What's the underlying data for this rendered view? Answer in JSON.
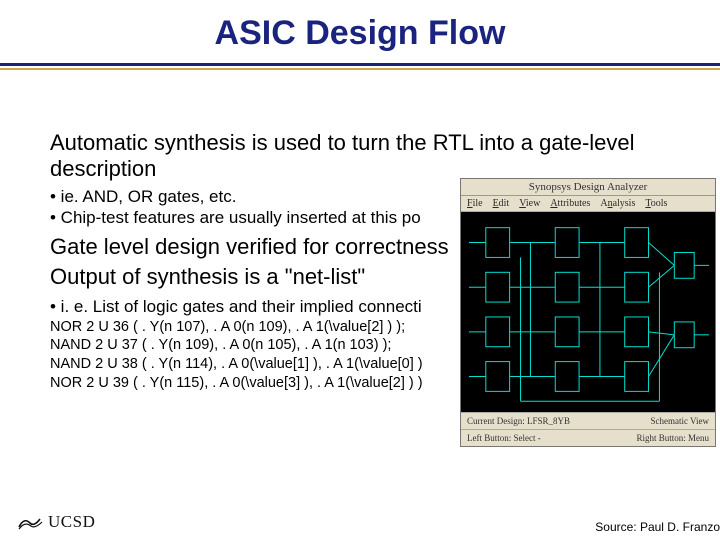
{
  "title": "ASIC Design Flow",
  "body": {
    "p1": "Automatic synthesis is used to turn the RTL into a gate-level description",
    "b1": "• ie. AND, OR gates, etc.",
    "b2": "• Chip-test features are usually inserted at this po",
    "p2": "Gate level design verified for correctness",
    "p3": "Output of synthesis is a \"net-list\"",
    "b3": "• i. e. List of logic gates and their implied connecti",
    "code1": "NOR 2 U 36 ( . Y(n 107), . A 0(n 109), . A 1(\\value[2] ) );",
    "code2": "NAND 2 U 37 ( . Y(n 109), . A 0(n 105), . A 1(n 103) );",
    "code3": "NAND 2 U 38 ( . Y(n 114), . A 0(\\value[1] ), . A 1(\\value[0] )",
    "code4": "NOR 2 U 39 ( . Y(n 115), . A 0(\\value[3] ), . A 1(\\value[2] ) )"
  },
  "figure": {
    "titlebar": "Synopsys Design Analyzer",
    "menu": {
      "file": "File",
      "edit": "Edit",
      "view": "View",
      "attr": "Attributes",
      "analysis": "Analysis",
      "tools": "Tools"
    },
    "toolbar_left": "Current Design:  LFSR_8YB",
    "toolbar_right": "Schematic View",
    "status_left": "Left Button: Select  -",
    "status_right": "Right Button: Menu"
  },
  "footer": "Source: Paul D. Franzo",
  "logo": "UCSD"
}
